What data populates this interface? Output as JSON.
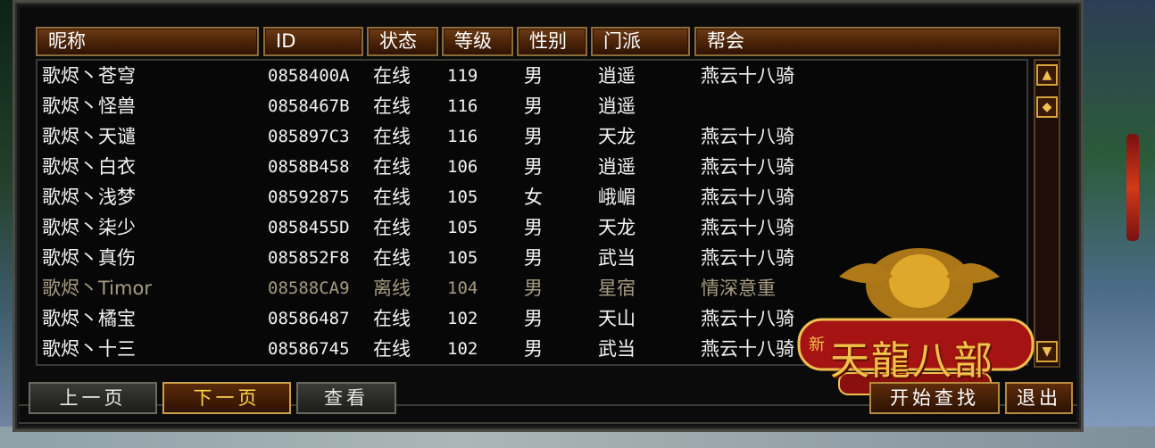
{
  "columns": {
    "nickname": "昵称",
    "id": "ID",
    "status": "状态",
    "level": "等级",
    "gender": "性别",
    "school": "门派",
    "guild": "帮会"
  },
  "rows": [
    {
      "name": "歌烬丶苍穹",
      "id": "0858400A",
      "status": "在线",
      "level": "119",
      "gender": "男",
      "school": "逍遥",
      "guild": "燕云十八骑"
    },
    {
      "name": "歌烬丶怪兽",
      "id": "0858467B",
      "status": "在线",
      "level": "116",
      "gender": "男",
      "school": "逍遥",
      "guild": ""
    },
    {
      "name": "歌烬丶天谴",
      "id": "085897C3",
      "status": "在线",
      "level": "116",
      "gender": "男",
      "school": "天龙",
      "guild": "燕云十八骑"
    },
    {
      "name": "歌烬丶白衣",
      "id": "0858B458",
      "status": "在线",
      "level": "106",
      "gender": "男",
      "school": "逍遥",
      "guild": "燕云十八骑"
    },
    {
      "name": "歌烬丶浅梦",
      "id": "08592875",
      "status": "在线",
      "level": "105",
      "gender": "女",
      "school": "峨嵋",
      "guild": "燕云十八骑"
    },
    {
      "name": "歌烬丶柒少",
      "id": "0858455D",
      "status": "在线",
      "level": "105",
      "gender": "男",
      "school": "天龙",
      "guild": "燕云十八骑"
    },
    {
      "name": "歌烬丶真伤",
      "id": "085852F8",
      "status": "在线",
      "level": "105",
      "gender": "男",
      "school": "武当",
      "guild": "燕云十八骑"
    },
    {
      "name": "歌烬丶Timor",
      "id": "08588CA9",
      "status": "离线",
      "level": "104",
      "gender": "男",
      "school": "星宿",
      "guild": "情深意重"
    },
    {
      "name": "歌烬丶橘宝",
      "id": "08586487",
      "status": "在线",
      "level": "102",
      "gender": "男",
      "school": "天山",
      "guild": "燕云十八骑"
    },
    {
      "name": "歌烬丶十三",
      "id": "08586745",
      "status": "在线",
      "level": "102",
      "gender": "男",
      "school": "武当",
      "guild": "燕云十八骑"
    }
  ],
  "buttons": {
    "prev": "上一页",
    "next": "下一页",
    "view": "查看",
    "search": "开始查找",
    "exit": "退出"
  },
  "logo": {
    "title": "天龍八部",
    "prefix": "新"
  },
  "icons": {
    "scroll_up": "scroll-up-icon",
    "scroll_thumb": "scroll-thumb-icon",
    "scroll_down": "scroll-down-icon"
  }
}
